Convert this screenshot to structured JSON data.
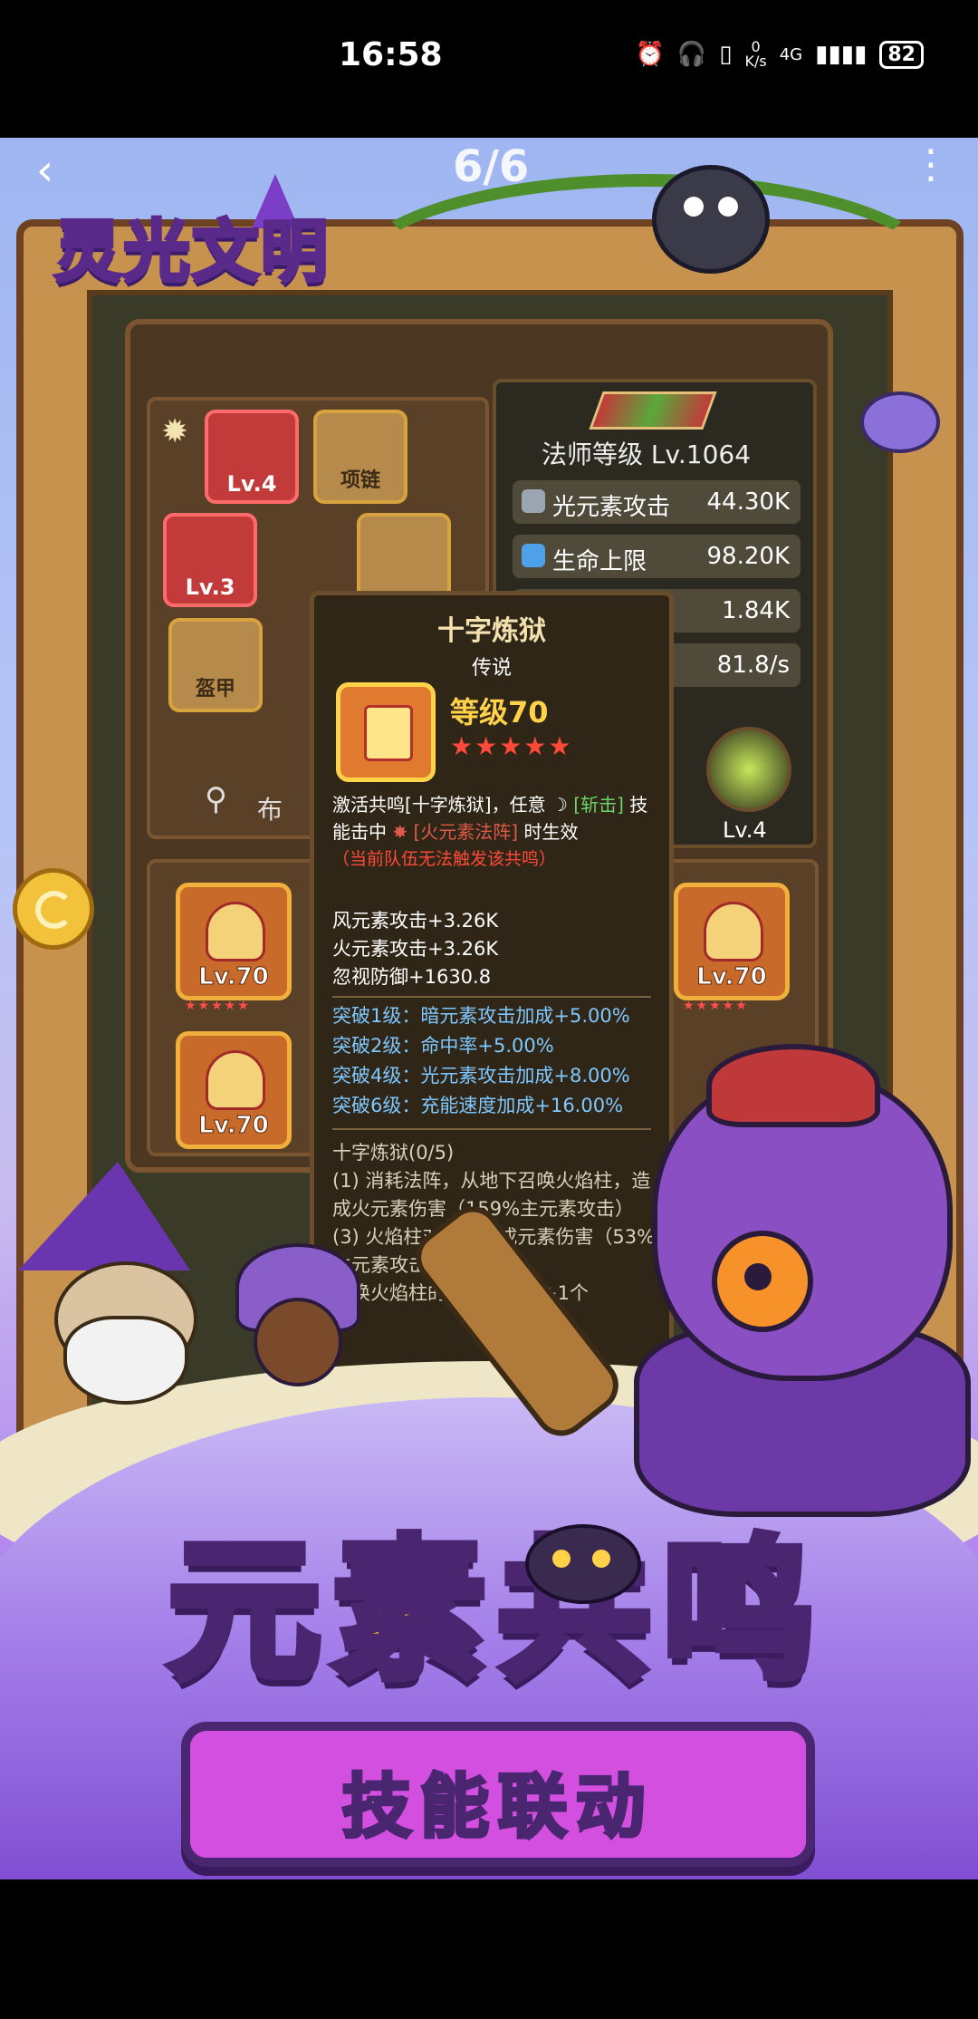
{
  "status_bar": {
    "time": "16:58",
    "net_speed": "0\nK/s",
    "network": "4G",
    "battery": "82"
  },
  "viewer": {
    "back_icon": "chevron-left-icon",
    "counter": "6/6",
    "more_icon": "more-vertical-icon"
  },
  "game": {
    "logo": "灵光文明",
    "equipment": {
      "slots": [
        {
          "level": "Lv.4"
        },
        {
          "name": "项链"
        },
        {
          "level": "Lv.3"
        },
        {
          "name": "盔甲"
        }
      ],
      "partial_label": "布"
    },
    "stats": {
      "rank": "法师等级 Lv.1064",
      "rows": [
        {
          "name": "光元素攻击",
          "value": "44.30K",
          "color": "#9aa7b3"
        },
        {
          "name": "生命上限",
          "value": "98.20K",
          "color": "#4ea0e8"
        },
        {
          "name": "",
          "value": "1.84K",
          "color": "#c9a54a"
        },
        {
          "name": "",
          "value": "81.8/s",
          "color": "#c9a54a"
        }
      ],
      "pet_level": "Lv.4"
    },
    "cards": [
      {
        "level": "Lv.70"
      },
      {
        "level": "Lv.70"
      },
      {
        "level": "Lv.70"
      }
    ],
    "tooltip": {
      "title": "十字炼狱",
      "rarity": "传说",
      "level": "等级70",
      "stars": "★★★★★",
      "desc_1": "激活共鸣[十字炼狱]，任意",
      "desc_green": "[斩击]",
      "desc_2": "技能击中",
      "desc_red": "[火元素法阵]",
      "desc_3": "时生效",
      "warning": "（当前队伍无法触发该共鸣）",
      "attrs": [
        "风元素攻击+3.26K",
        "火元素攻击+3.26K",
        "忽视防御+1630.8"
      ],
      "breakthroughs": [
        "突破1级：暗元素攻击加成+5.00%",
        "突破2级：命中率+5.00%",
        "突破4级：光元素攻击加成+8.00%",
        "突破6级：充能速度加成+16.00%"
      ],
      "skill_title": "十字炼狱(0/5)",
      "skill_text": "(1) 消耗法阵，从地下召唤火焰柱，造成火元素伤害（159%主元素攻击）",
      "skill_text_2": "(3) 火焰柱对敌人造成元素伤害（53%主元素攻击），持续6秒",
      "skill_text_3": "召唤火焰柱的火焰柱数量+1个"
    }
  },
  "promo": {
    "title_1": "元",
    "title_2": "素",
    "title_3": "共",
    "title_4": "鸣",
    "subtitle": "技能联动"
  }
}
